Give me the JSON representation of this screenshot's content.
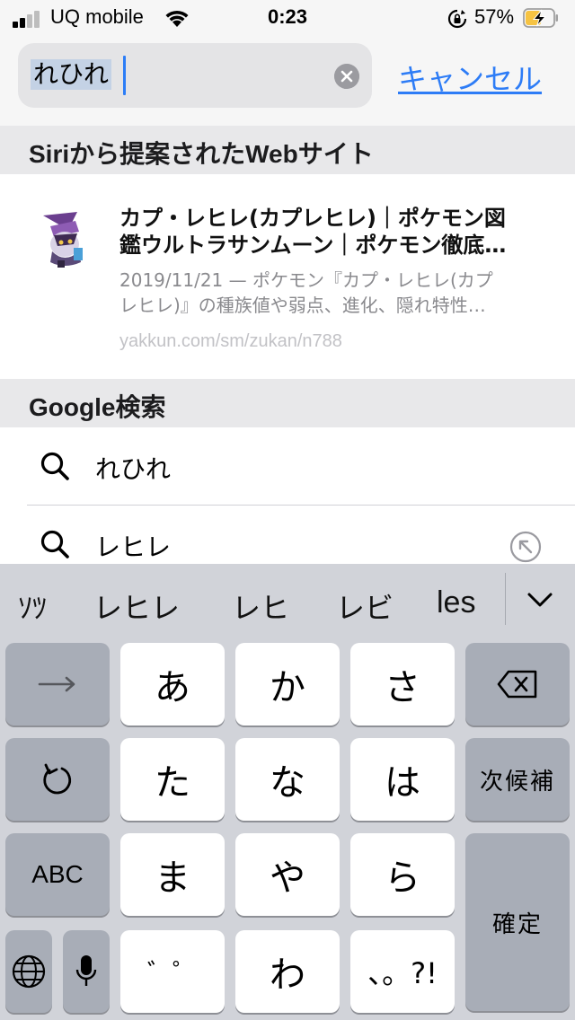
{
  "status_bar": {
    "carrier": "UQ mobile",
    "time": "0:23",
    "battery_percent": "57%",
    "battery_level": 0.57
  },
  "search": {
    "query": "れひれ",
    "cancel_label": "キャンセル"
  },
  "siri": {
    "header": "Siriから提案されたWebサイト",
    "result": {
      "title": "カプ・レヒレ(カプレヒレ)｜ポケモン図\n鑑ウルトラサンムーン｜ポケモン徹底…",
      "snippet": "2019/11/21 — ポケモン『カプ・レヒレ(カプ\nレヒレ)』の種族値や弱点、進化、隠れ特性…",
      "url": "yakkun.com/sm/zukan/n788"
    }
  },
  "google": {
    "header": "Google検索",
    "suggestions": [
      "れひれ",
      "レヒレ"
    ]
  },
  "keyboard": {
    "candidates": [
      "ｿﾂ",
      "レヒレ",
      "レヒ",
      "レビ",
      "les"
    ],
    "keys": {
      "a": "あ",
      "ka": "か",
      "sa": "さ",
      "ta": "た",
      "na": "な",
      "ha": "は",
      "ma": "ま",
      "ya": "や",
      "ra": "ら",
      "dakuten": "゛゜",
      "wa": "わ",
      "punct": "、。?!",
      "abc": "ABC",
      "next_candidate": "次候補",
      "confirm": "確定"
    }
  },
  "colors": {
    "accent": "#2d7cf6",
    "keyboard_bg": "#d1d3d9",
    "dark_key": "#a8adb7"
  }
}
